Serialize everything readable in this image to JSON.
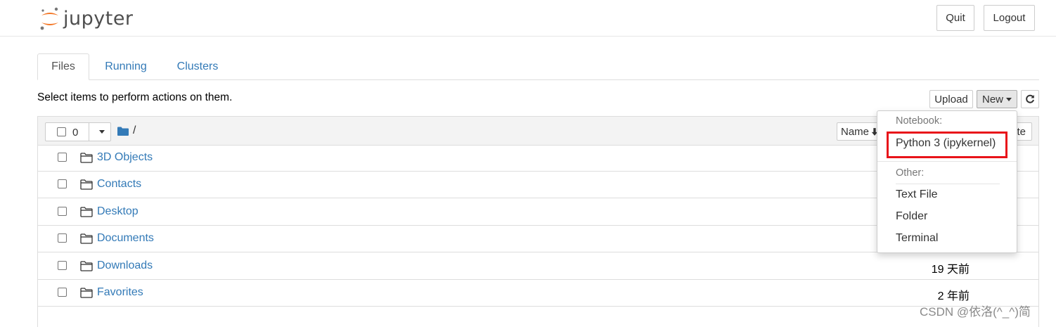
{
  "app": {
    "name": "jupyter"
  },
  "header": {
    "quit_label": "Quit",
    "logout_label": "Logout"
  },
  "tabs": [
    {
      "label": "Files",
      "active": true
    },
    {
      "label": "Running",
      "active": false
    },
    {
      "label": "Clusters",
      "active": false
    }
  ],
  "toolbar": {
    "hint": "Select items to perform actions on them.",
    "upload_label": "Upload",
    "new_label": "New",
    "refresh_icon": "refresh-icon"
  },
  "list_header": {
    "selected_count": "0",
    "breadcrumb": "/",
    "sort_name_label": "Name",
    "sort_right_label_partial": "te"
  },
  "files": [
    {
      "name": "3D Objects",
      "modified": ""
    },
    {
      "name": "Contacts",
      "modified": ""
    },
    {
      "name": "Desktop",
      "modified": ""
    },
    {
      "name": "Documents",
      "modified": ""
    },
    {
      "name": "Downloads",
      "modified": "19 天前"
    },
    {
      "name": "Favorites",
      "modified": "2 年前"
    }
  ],
  "new_menu": {
    "notebook_header": "Notebook:",
    "notebook_items": [
      "Python 3 (ipykernel)"
    ],
    "other_header": "Other:",
    "other_items": [
      "Text File",
      "Folder",
      "Terminal"
    ]
  },
  "watermark": "CSDN @依洛(^_^)简",
  "colors": {
    "link": "#337ab7",
    "highlight": "#e8131a",
    "logo_orange": "#f37726"
  }
}
